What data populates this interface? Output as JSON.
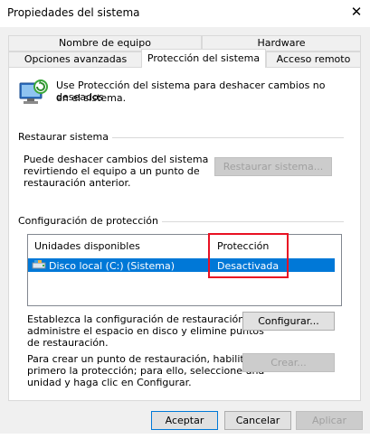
{
  "window": {
    "title": "Propiedades del sistema",
    "close_glyph": "✕"
  },
  "tabs": {
    "row1": [
      "Nombre de equipo",
      "Hardware"
    ],
    "row2": [
      "Opciones avanzadas",
      "Protección del sistema",
      "Acceso remoto"
    ],
    "active": "Protección del sistema"
  },
  "intro": {
    "icon": "system-protection-icon",
    "text_line1": "Use Protección del sistema para deshacer cambios no deseados",
    "text_line2": "en el sistema."
  },
  "restore": {
    "group_label": "Restaurar sistema",
    "desc_line1": "Puede deshacer cambios del sistema",
    "desc_line2": "revirtiendo el equipo a un punto de",
    "desc_line3": "restauración anterior.",
    "button": "Restaurar sistema..."
  },
  "protection": {
    "group_label": "Configuración de protección",
    "col_drives": "Unidades disponibles",
    "col_protection": "Protección",
    "rows": [
      {
        "drive": "Disco local (C:) (Sistema)",
        "protection": "Desactivada",
        "icon": "drive-icon"
      }
    ]
  },
  "configure": {
    "desc_line1": "Establezca la configuración de restauración,",
    "desc_line2": "administre el espacio en disco y elimine puntos",
    "desc_line3": "de restauración.",
    "button": "Configurar..."
  },
  "create": {
    "desc_line1": "Para crear un punto de restauración, habilite",
    "desc_line2": "primero la protección; para ello, seleccione una",
    "desc_line3": "unidad y haga clic en Configurar.",
    "button": "Crear..."
  },
  "footer": {
    "ok": "Aceptar",
    "cancel": "Cancelar",
    "apply": "Aplicar"
  },
  "colors": {
    "selection": "#0078d7",
    "highlight_box": "#e81123"
  }
}
